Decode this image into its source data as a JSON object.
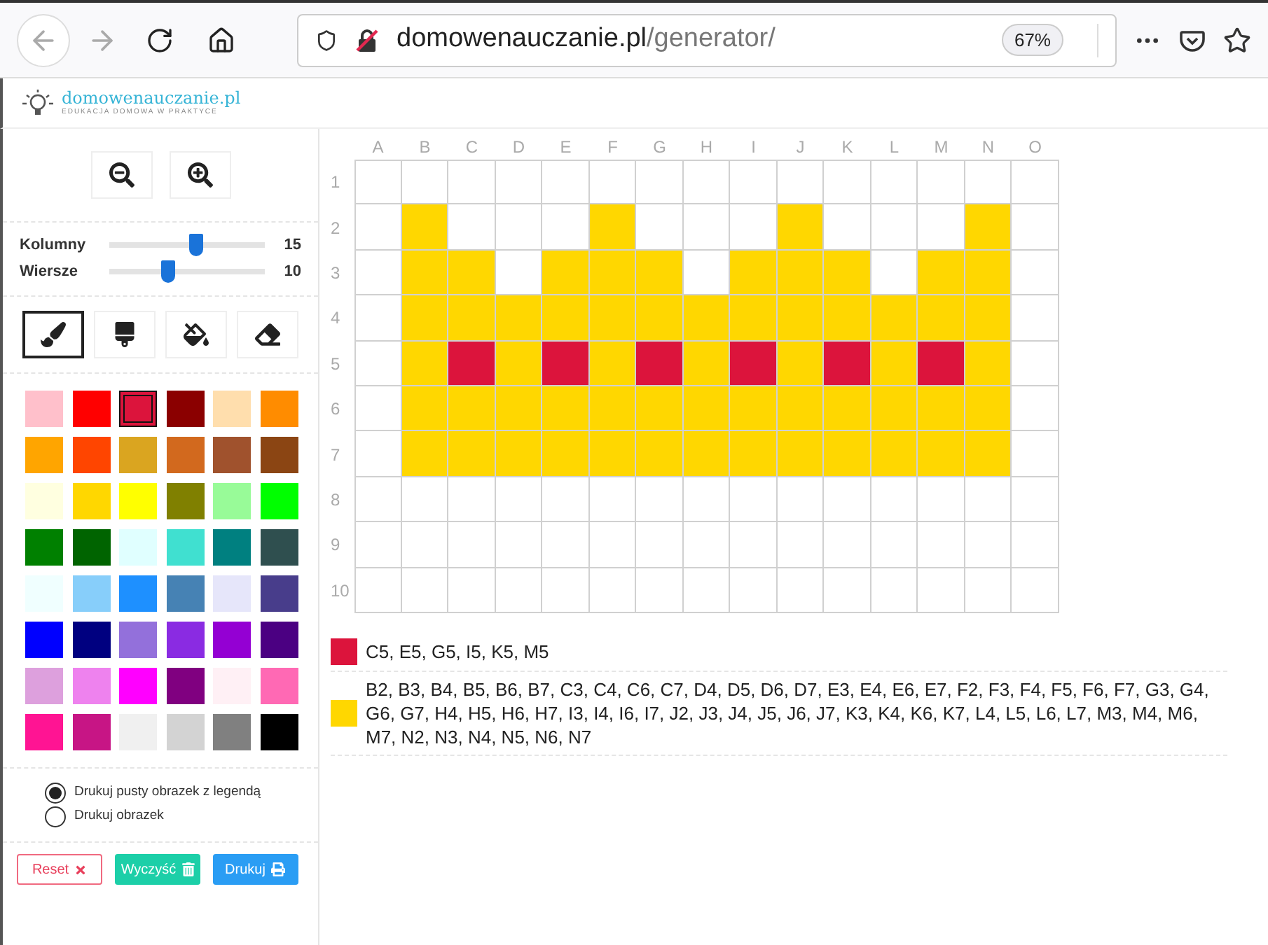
{
  "browser": {
    "url_host": "domowenauczanie.pl",
    "url_path": "/generator/",
    "zoom": "67%"
  },
  "logo": {
    "name": "domowenauczanie.pl",
    "tagline": "EDUKACJA DOMOWA W PRAKTYCE"
  },
  "sliders": [
    {
      "label": "Kolumny",
      "level": 0.56,
      "value": "15"
    },
    {
      "label": "Wiersze",
      "level": 0.38,
      "value": "10"
    }
  ],
  "tools": [
    {
      "kind": "brush",
      "selected": true
    },
    {
      "kind": "roller",
      "selected": false
    },
    {
      "kind": "bucket",
      "selected": false
    },
    {
      "kind": "eraser",
      "selected": false
    }
  ],
  "palette": [
    {
      "color": "#ffc0cb",
      "selected": false
    },
    {
      "color": "#ff0000",
      "selected": false
    },
    {
      "color": "#dc143c",
      "selected": true
    },
    {
      "color": "#8b0000",
      "selected": false
    },
    {
      "color": "#ffdead",
      "selected": false
    },
    {
      "color": "#ff8c00",
      "selected": false
    },
    {
      "color": "#ffa500",
      "selected": false
    },
    {
      "color": "#ff4500",
      "selected": false
    },
    {
      "color": "#daa520",
      "selected": false
    },
    {
      "color": "#d2691e",
      "selected": false
    },
    {
      "color": "#a0522d",
      "selected": false
    },
    {
      "color": "#8b4513",
      "selected": false
    },
    {
      "color": "#ffffe0",
      "selected": false
    },
    {
      "color": "#ffd700",
      "selected": false
    },
    {
      "color": "#ffff00",
      "selected": false
    },
    {
      "color": "#808000",
      "selected": false
    },
    {
      "color": "#98fb98",
      "selected": false
    },
    {
      "color": "#00ff00",
      "selected": false
    },
    {
      "color": "#008000",
      "selected": false
    },
    {
      "color": "#006400",
      "selected": false
    },
    {
      "color": "#e0ffff",
      "selected": false
    },
    {
      "color": "#40e0d0",
      "selected": false
    },
    {
      "color": "#008080",
      "selected": false
    },
    {
      "color": "#2f4f4f",
      "selected": false
    },
    {
      "color": "#f0ffff",
      "selected": false
    },
    {
      "color": "#87cefa",
      "selected": false
    },
    {
      "color": "#1e90ff",
      "selected": false
    },
    {
      "color": "#4682b4",
      "selected": false
    },
    {
      "color": "#e6e6fa",
      "selected": false
    },
    {
      "color": "#483d8b",
      "selected": false
    },
    {
      "color": "#0000ff",
      "selected": false
    },
    {
      "color": "#000080",
      "selected": false
    },
    {
      "color": "#9370db",
      "selected": false
    },
    {
      "color": "#8a2be2",
      "selected": false
    },
    {
      "color": "#9400d3",
      "selected": false
    },
    {
      "color": "#4b0082",
      "selected": false
    },
    {
      "color": "#dda0dd",
      "selected": false
    },
    {
      "color": "#ee82ee",
      "selected": false
    },
    {
      "color": "#ff00ff",
      "selected": false
    },
    {
      "color": "#800080",
      "selected": false
    },
    {
      "color": "#fff0f5",
      "selected": false
    },
    {
      "color": "#ff69b4",
      "selected": false
    },
    {
      "color": "#ff1493",
      "selected": false
    },
    {
      "color": "#c71585",
      "selected": false
    },
    {
      "color": "#f0f0f0",
      "selected": false
    },
    {
      "color": "#d3d3d3",
      "selected": false
    },
    {
      "color": "#808080",
      "selected": false
    },
    {
      "color": "#000000",
      "selected": false
    }
  ],
  "print_options": [
    {
      "label": "Drukuj pusty obrazek z legendą",
      "selected": true
    },
    {
      "label": "Drukuj obrazek",
      "selected": false
    }
  ],
  "buttons": [
    {
      "kind": "reset",
      "label": "Reset"
    },
    {
      "kind": "clear",
      "label": "Wyczyść"
    },
    {
      "kind": "print",
      "label": "Drukuj"
    }
  ],
  "grid": {
    "columns": [
      "A",
      "B",
      "C",
      "D",
      "E",
      "F",
      "G",
      "H",
      "I",
      "J",
      "K",
      "L",
      "M",
      "N",
      "O"
    ],
    "rows": [
      {
        "label": "1",
        "cells": [
          {
            "painted": false
          },
          {
            "painted": false
          },
          {
            "painted": false
          },
          {
            "painted": false
          },
          {
            "painted": false
          },
          {
            "painted": false
          },
          {
            "painted": false
          },
          {
            "painted": false
          },
          {
            "painted": false
          },
          {
            "painted": false
          },
          {
            "painted": false
          },
          {
            "painted": false
          },
          {
            "painted": false
          },
          {
            "painted": false
          },
          {
            "painted": false
          }
        ]
      },
      {
        "label": "2",
        "cells": [
          {
            "painted": false
          },
          {
            "painted": true,
            "color": "#ffd700"
          },
          {
            "painted": false
          },
          {
            "painted": false
          },
          {
            "painted": false
          },
          {
            "painted": true,
            "color": "#ffd700"
          },
          {
            "painted": false
          },
          {
            "painted": false
          },
          {
            "painted": false
          },
          {
            "painted": true,
            "color": "#ffd700"
          },
          {
            "painted": false
          },
          {
            "painted": false
          },
          {
            "painted": false
          },
          {
            "painted": true,
            "color": "#ffd700"
          },
          {
            "painted": false
          }
        ]
      },
      {
        "label": "3",
        "cells": [
          {
            "painted": false
          },
          {
            "painted": true,
            "color": "#ffd700"
          },
          {
            "painted": true,
            "color": "#ffd700"
          },
          {
            "painted": false
          },
          {
            "painted": true,
            "color": "#ffd700"
          },
          {
            "painted": true,
            "color": "#ffd700"
          },
          {
            "painted": true,
            "color": "#ffd700"
          },
          {
            "painted": false
          },
          {
            "painted": true,
            "color": "#ffd700"
          },
          {
            "painted": true,
            "color": "#ffd700"
          },
          {
            "painted": true,
            "color": "#ffd700"
          },
          {
            "painted": false
          },
          {
            "painted": true,
            "color": "#ffd700"
          },
          {
            "painted": true,
            "color": "#ffd700"
          },
          {
            "painted": false
          }
        ]
      },
      {
        "label": "4",
        "cells": [
          {
            "painted": false
          },
          {
            "painted": true,
            "color": "#ffd700"
          },
          {
            "painted": true,
            "color": "#ffd700"
          },
          {
            "painted": true,
            "color": "#ffd700"
          },
          {
            "painted": true,
            "color": "#ffd700"
          },
          {
            "painted": true,
            "color": "#ffd700"
          },
          {
            "painted": true,
            "color": "#ffd700"
          },
          {
            "painted": true,
            "color": "#ffd700"
          },
          {
            "painted": true,
            "color": "#ffd700"
          },
          {
            "painted": true,
            "color": "#ffd700"
          },
          {
            "painted": true,
            "color": "#ffd700"
          },
          {
            "painted": true,
            "color": "#ffd700"
          },
          {
            "painted": true,
            "color": "#ffd700"
          },
          {
            "painted": true,
            "color": "#ffd700"
          },
          {
            "painted": false
          }
        ]
      },
      {
        "label": "5",
        "cells": [
          {
            "painted": false
          },
          {
            "painted": true,
            "color": "#ffd700"
          },
          {
            "painted": true,
            "color": "#dc143c"
          },
          {
            "painted": true,
            "color": "#ffd700"
          },
          {
            "painted": true,
            "color": "#dc143c"
          },
          {
            "painted": true,
            "color": "#ffd700"
          },
          {
            "painted": true,
            "color": "#dc143c"
          },
          {
            "painted": true,
            "color": "#ffd700"
          },
          {
            "painted": true,
            "color": "#dc143c"
          },
          {
            "painted": true,
            "color": "#ffd700"
          },
          {
            "painted": true,
            "color": "#dc143c"
          },
          {
            "painted": true,
            "color": "#ffd700"
          },
          {
            "painted": true,
            "color": "#dc143c"
          },
          {
            "painted": true,
            "color": "#ffd700"
          },
          {
            "painted": false
          }
        ]
      },
      {
        "label": "6",
        "cells": [
          {
            "painted": false
          },
          {
            "painted": true,
            "color": "#ffd700"
          },
          {
            "painted": true,
            "color": "#ffd700"
          },
          {
            "painted": true,
            "color": "#ffd700"
          },
          {
            "painted": true,
            "color": "#ffd700"
          },
          {
            "painted": true,
            "color": "#ffd700"
          },
          {
            "painted": true,
            "color": "#ffd700"
          },
          {
            "painted": true,
            "color": "#ffd700"
          },
          {
            "painted": true,
            "color": "#ffd700"
          },
          {
            "painted": true,
            "color": "#ffd700"
          },
          {
            "painted": true,
            "color": "#ffd700"
          },
          {
            "painted": true,
            "color": "#ffd700"
          },
          {
            "painted": true,
            "color": "#ffd700"
          },
          {
            "painted": true,
            "color": "#ffd700"
          },
          {
            "painted": false
          }
        ]
      },
      {
        "label": "7",
        "cells": [
          {
            "painted": false
          },
          {
            "painted": true,
            "color": "#ffd700"
          },
          {
            "painted": true,
            "color": "#ffd700"
          },
          {
            "painted": true,
            "color": "#ffd700"
          },
          {
            "painted": true,
            "color": "#ffd700"
          },
          {
            "painted": true,
            "color": "#ffd700"
          },
          {
            "painted": true,
            "color": "#ffd700"
          },
          {
            "painted": true,
            "color": "#ffd700"
          },
          {
            "painted": true,
            "color": "#ffd700"
          },
          {
            "painted": true,
            "color": "#ffd700"
          },
          {
            "painted": true,
            "color": "#ffd700"
          },
          {
            "painted": true,
            "color": "#ffd700"
          },
          {
            "painted": true,
            "color": "#ffd700"
          },
          {
            "painted": true,
            "color": "#ffd700"
          },
          {
            "painted": false
          }
        ]
      },
      {
        "label": "8",
        "cells": [
          {
            "painted": false
          },
          {
            "painted": false
          },
          {
            "painted": false
          },
          {
            "painted": false
          },
          {
            "painted": false
          },
          {
            "painted": false
          },
          {
            "painted": false
          },
          {
            "painted": false
          },
          {
            "painted": false
          },
          {
            "painted": false
          },
          {
            "painted": false
          },
          {
            "painted": false
          },
          {
            "painted": false
          },
          {
            "painted": false
          },
          {
            "painted": false
          }
        ]
      },
      {
        "label": "9",
        "cells": [
          {
            "painted": false
          },
          {
            "painted": false
          },
          {
            "painted": false
          },
          {
            "painted": false
          },
          {
            "painted": false
          },
          {
            "painted": false
          },
          {
            "painted": false
          },
          {
            "painted": false
          },
          {
            "painted": false
          },
          {
            "painted": false
          },
          {
            "painted": false
          },
          {
            "painted": false
          },
          {
            "painted": false
          },
          {
            "painted": false
          },
          {
            "painted": false
          }
        ]
      },
      {
        "label": "10",
        "cells": [
          {
            "painted": false
          },
          {
            "painted": false
          },
          {
            "painted": false
          },
          {
            "painted": false
          },
          {
            "painted": false
          },
          {
            "painted": false
          },
          {
            "painted": false
          },
          {
            "painted": false
          },
          {
            "painted": false
          },
          {
            "painted": false
          },
          {
            "painted": false
          },
          {
            "painted": false
          },
          {
            "painted": false
          },
          {
            "painted": false
          },
          {
            "painted": false
          }
        ]
      }
    ]
  },
  "legend": [
    {
      "color": "#dc143c",
      "cells": "C5, E5, G5, I5, K5, M5"
    },
    {
      "color": "#ffd700",
      "cells": "B2, B3, B4, B5, B6, B7, C3, C4, C6, C7, D4, D5, D6, D7, E3, E4, E6, E7, F2, F3, F4, F5, F6, F7, G3, G4, G6, G7, H4, H5, H6, H7, I3, I4, I6, I7, J2, J3, J4, J5, J6, J7, K3, K4, K6, K7, L4, L5, L6, L7, M3, M4, M6, M7, N2, N3, N4, N5, N6, N7"
    }
  ]
}
